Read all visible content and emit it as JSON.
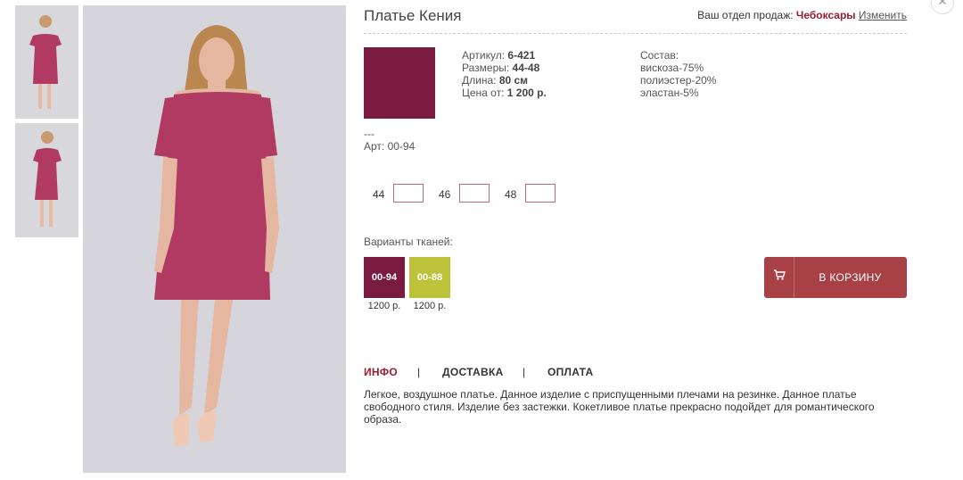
{
  "product": {
    "title": "Платье Кения",
    "swatch_color": "#7a1a3f"
  },
  "region": {
    "label": "Ваш отдел продаж:",
    "city": "Чебоксары",
    "change": "Изменить"
  },
  "specs": {
    "article_label": "Артикул:",
    "article_value": "6-421",
    "sizes_label": "Размеры:",
    "sizes_value": "44-48",
    "length_label": "Длина:",
    "length_value": "80 см",
    "price_label": "Цена от:",
    "price_value": "1 200 р."
  },
  "composition": {
    "title": "Состав:",
    "items": [
      "вискоза-75%",
      "полиэстер-20%",
      "эластан-5%"
    ]
  },
  "variant": {
    "dash": "---",
    "art": "Арт: 00-94"
  },
  "sizes": [
    "44",
    "46",
    "48"
  ],
  "fabrics": {
    "label": "Варианты тканей:",
    "items": [
      {
        "code": "00-94",
        "price": "1200 р.",
        "color": "#7a1a3f"
      },
      {
        "code": "00-88",
        "price": "1200 р.",
        "color": "#bcc23a"
      }
    ]
  },
  "cart": {
    "label": "В КОРЗИНУ",
    "icon": "cart-icon"
  },
  "tabs": [
    "ИНФО",
    "ДОСТАВКА",
    "ОПЛАТА"
  ],
  "tab_separator": "|",
  "description": "Легкое, воздушное платье. Данное изделие с приспущенными плечами на резинке. Данное платье свободного стиля. Изделие без застежки. Кокетливое платье прекрасно подойдет для романтического образа.",
  "colors": {
    "accent": "#9b1b30",
    "cart_button": "#a84145",
    "dress": "#b03a62"
  }
}
